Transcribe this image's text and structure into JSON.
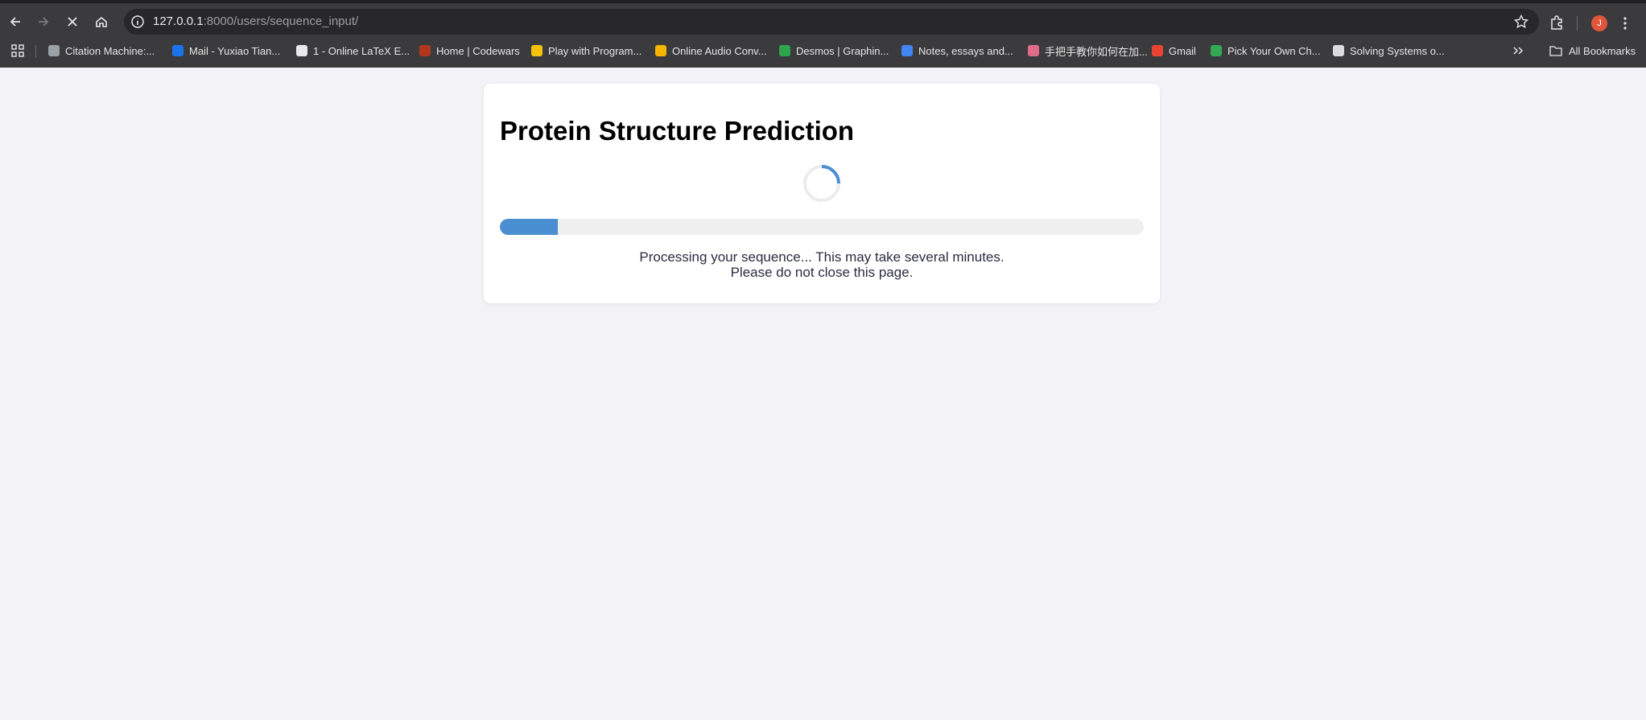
{
  "browser": {
    "url_host": "127.0.0.1",
    "url_rest": ":8000/users/sequence_input/",
    "profile_initial": "J",
    "bookmarks": [
      {
        "label": "Citation Machine:...",
        "color": "#9aa0a6"
      },
      {
        "label": "Mail - Yuxiao Tian...",
        "color": "#1a73e8"
      },
      {
        "label": "1 - Online LaTeX E...",
        "color": "#e8eaed"
      },
      {
        "label": "Home | Codewars",
        "color": "#b1361e"
      },
      {
        "label": "Play with Program...",
        "color": "#f4c20d"
      },
      {
        "label": "Online Audio Conv...",
        "color": "#f4b400"
      },
      {
        "label": "Desmos | Graphin...",
        "color": "#2ea44f"
      },
      {
        "label": "Notes, essays and...",
        "color": "#4285f4"
      },
      {
        "label": "手把手教你如何在加...",
        "color": "#e06c8a"
      },
      {
        "label": "Gmail",
        "color": "#ea4335"
      },
      {
        "label": "Pick Your Own Ch...",
        "color": "#34a853"
      },
      {
        "label": "Solving Systems o...",
        "color": "#dadce0"
      }
    ],
    "all_bookmarks_label": "All Bookmarks"
  },
  "page": {
    "title": "Protein Structure Prediction",
    "progress_percent": 9,
    "status_line1": "Processing your sequence... This may take several minutes.",
    "status_line2": "Please do not close this page.",
    "accent_color": "#4a8fd1"
  }
}
